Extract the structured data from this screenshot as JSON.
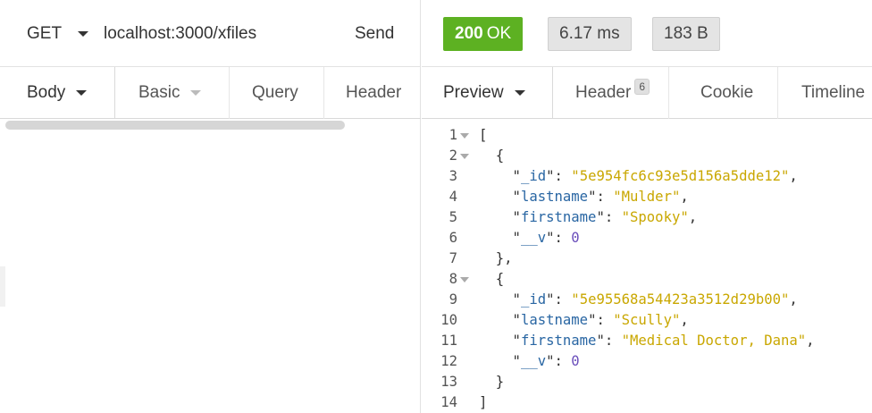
{
  "request": {
    "method": "GET",
    "url": "localhost:3000/xfiles",
    "send_label": "Send",
    "tabs": [
      {
        "label": "Body"
      },
      {
        "label": "Basic"
      },
      {
        "label": "Query"
      },
      {
        "label": "Header"
      }
    ]
  },
  "response": {
    "status_code": "200",
    "status_text": "OK",
    "time": "6.17 ms",
    "size": "183 B",
    "tabs": [
      {
        "label": "Preview"
      },
      {
        "label": "Header",
        "badge": "6"
      },
      {
        "label": "Cookie"
      },
      {
        "label": "Timeline"
      }
    ],
    "lines": [
      {
        "n": "1",
        "text": "["
      },
      {
        "n": "2",
        "text": "  {"
      },
      {
        "n": "3",
        "key": "_id",
        "value": "5e954fc6c93e5d156a5dde12"
      },
      {
        "n": "4",
        "key": "lastname",
        "value": "Mulder"
      },
      {
        "n": "5",
        "key": "firstname",
        "value": "Spooky"
      },
      {
        "n": "6",
        "key": "__v",
        "num": "0"
      },
      {
        "n": "7",
        "text": "  },"
      },
      {
        "n": "8",
        "text": "  {"
      },
      {
        "n": "9",
        "key": "_id",
        "value": "5e95568a54423a3512d29b00"
      },
      {
        "n": "10",
        "key": "lastname",
        "value": "Scully"
      },
      {
        "n": "11",
        "key": "firstname",
        "value": "Medical Doctor, Dana"
      },
      {
        "n": "12",
        "key": "__v",
        "num": "0"
      },
      {
        "n": "13",
        "text": "  }"
      },
      {
        "n": "14",
        "text": "]"
      }
    ]
  },
  "colors": {
    "status_ok": "#5db122",
    "json_key": "#2966a3",
    "json_string": "#c9a700",
    "json_number": "#6b4fbb"
  }
}
